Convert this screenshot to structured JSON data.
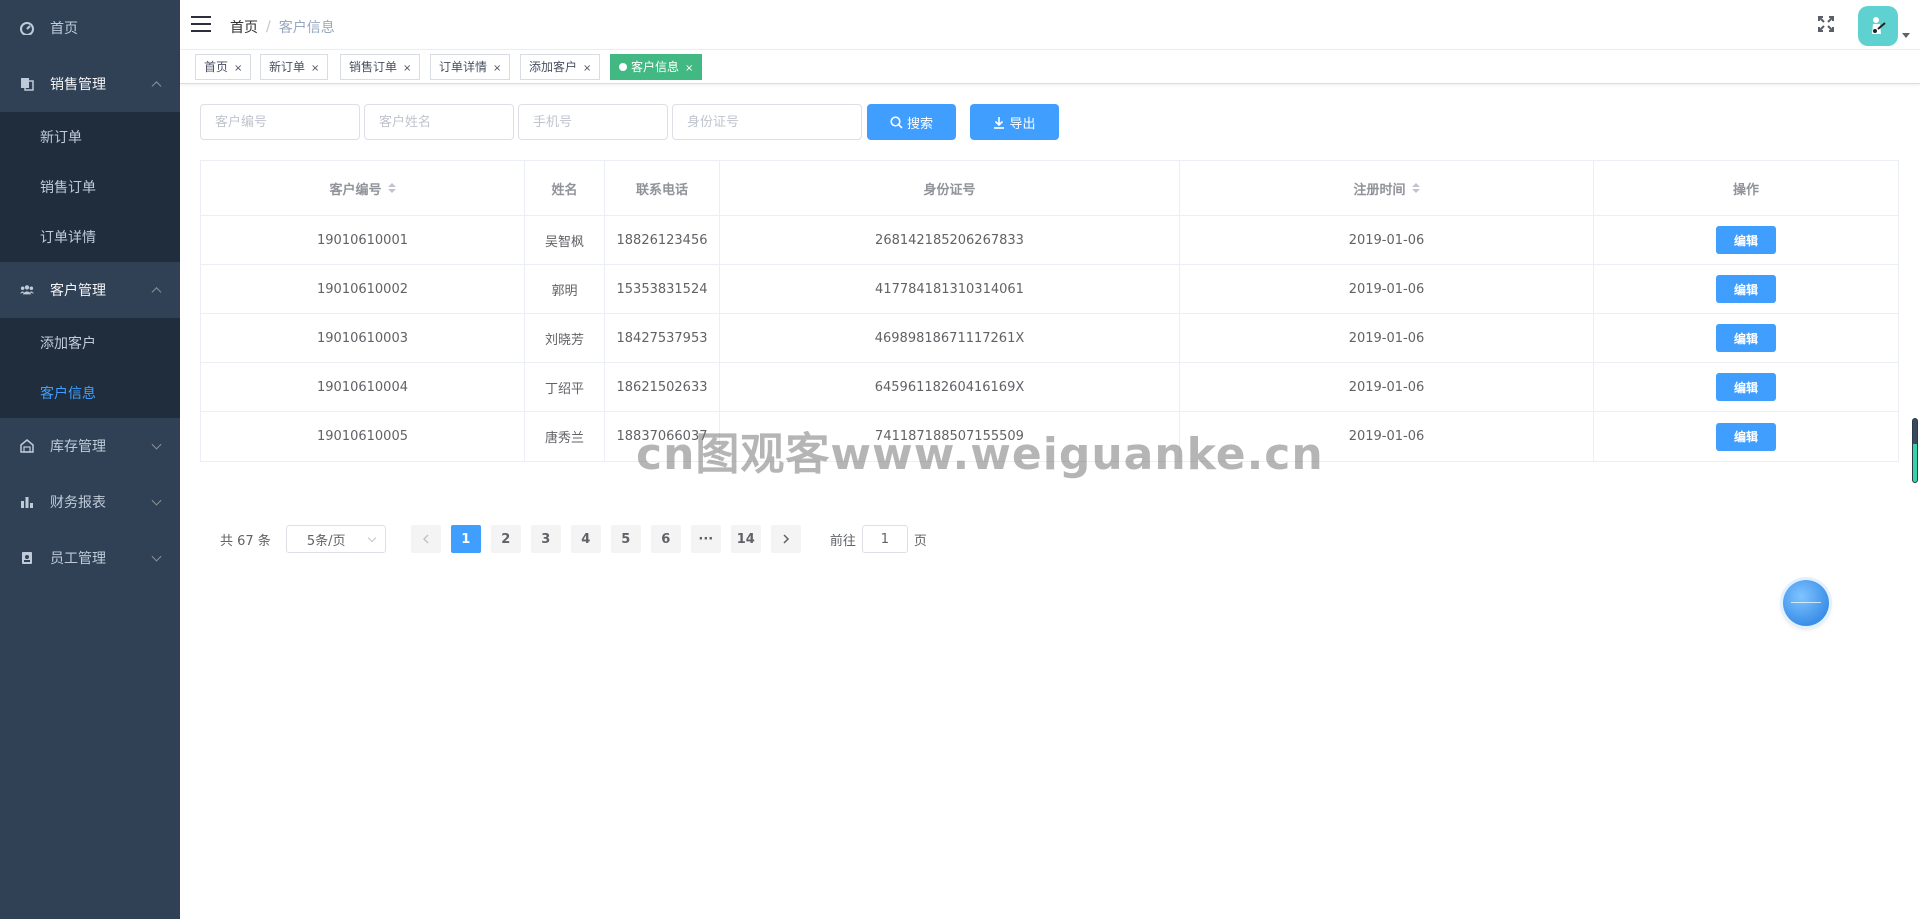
{
  "sidebar": {
    "menus": [
      {
        "label": "首页",
        "icon": "dashboard-icon",
        "expandable": false,
        "open": false
      },
      {
        "label": "销售管理",
        "icon": "copy-icon",
        "expandable": true,
        "open": true,
        "children": [
          "新订单",
          "销售订单",
          "订单详情"
        ]
      },
      {
        "label": "客户管理",
        "icon": "users-icon",
        "expandable": true,
        "open": true,
        "children": [
          "添加客户",
          "客户信息"
        ]
      },
      {
        "label": "库存管理",
        "icon": "warehouse-icon",
        "expandable": true,
        "open": false
      },
      {
        "label": "财务报表",
        "icon": "bar-chart-icon",
        "expandable": true,
        "open": false
      },
      {
        "label": "员工管理",
        "icon": "id-badge-icon",
        "expandable": true,
        "open": false
      }
    ],
    "active_child": "客户信息"
  },
  "header": {
    "breadcrumb": [
      "首页",
      "客户信息"
    ]
  },
  "tags": [
    {
      "label": "首页",
      "active": false
    },
    {
      "label": "新订单",
      "active": false
    },
    {
      "label": "销售订单",
      "active": false
    },
    {
      "label": "订单详情",
      "active": false
    },
    {
      "label": "添加客户",
      "active": false
    },
    {
      "label": "客户信息",
      "active": true
    }
  ],
  "filter": {
    "placeholders": [
      "客户编号",
      "客户姓名",
      "手机号",
      "身份证号"
    ],
    "search_label": "搜索",
    "export_label": "导出"
  },
  "table": {
    "columns": [
      "客户编号",
      "姓名",
      "联系电话",
      "身份证号",
      "注册时间",
      "操作"
    ],
    "sortable": [
      true,
      false,
      false,
      false,
      true,
      false
    ],
    "rows": [
      [
        "19010610001",
        "吴智枫",
        "18826123456",
        "268142185206267833",
        "2019-01-06"
      ],
      [
        "19010610002",
        "郭明",
        "15353831524",
        "417784181310314061",
        "2019-01-06"
      ],
      [
        "19010610003",
        "刘晓芳",
        "18427537953",
        "46989818671117261X",
        "2019-01-06"
      ],
      [
        "19010610004",
        "丁绍平",
        "18621502633",
        "64596118260416169X",
        "2019-01-06"
      ],
      [
        "19010610005",
        "唐秀兰",
        "18837066037",
        "741187188507155509",
        "2019-01-06"
      ]
    ],
    "edit_label": "编辑"
  },
  "pagination": {
    "total_text": "共 67 条",
    "page_size": "5条/页",
    "pages": [
      "1",
      "2",
      "3",
      "4",
      "5",
      "6",
      "···",
      "14"
    ],
    "current": "1",
    "goto_prefix": "前往",
    "goto_value": "1",
    "goto_suffix": "页"
  },
  "watermark": "cn图观客www.weiguanke.cn",
  "colors": {
    "sidebar_bg": "#304156",
    "submenu_bg": "#1f2d3d",
    "primary": "#409eff",
    "tag_active": "#42b983"
  }
}
